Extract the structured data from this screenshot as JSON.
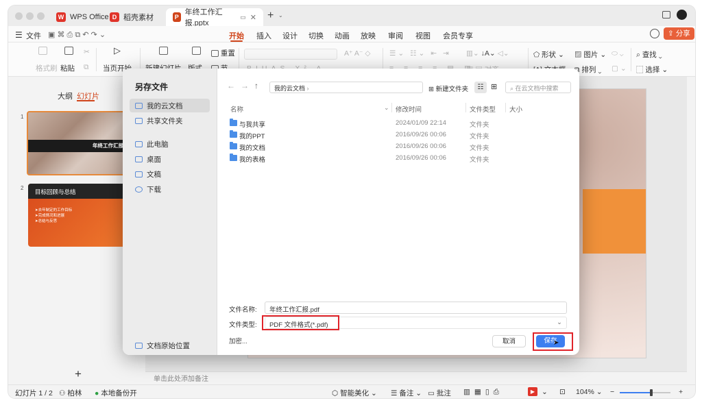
{
  "tabs": [
    {
      "label": "WPS Office",
      "icon": "wps-logo-icon"
    },
    {
      "label": "稻壳素材",
      "icon": "docer-logo-icon"
    },
    {
      "label": "年终工作汇报.pptx",
      "icon": "presentation-icon"
    }
  ],
  "menu": {
    "file": "文件",
    "items": [
      "开始",
      "插入",
      "设计",
      "切换",
      "动画",
      "放映",
      "审阅",
      "视图",
      "会员专享"
    ],
    "active": "开始",
    "share": "分享"
  },
  "ribbon": {
    "format_painter": "格式刷",
    "paste": "粘贴",
    "from_current": "当页开始",
    "new_slide": "新建幻灯片",
    "layout": "版式",
    "section": "节",
    "reset": "重置",
    "shape": "形状",
    "picture": "图片",
    "find": "查找",
    "textbox": "文本框",
    "arrange": "排列",
    "select": "选择",
    "align": "对齐"
  },
  "left_panel": {
    "tabs": [
      "大纲",
      "幻灯片"
    ],
    "active_tab": "幻灯片",
    "slides": [
      {
        "num": "1",
        "title": "年终工作汇报"
      },
      {
        "num": "2",
        "title": "目标回顾与总结",
        "bullets": [
          "去年制定的工作目标",
          "完成情况和进展",
          "总结与反思"
        ]
      }
    ],
    "add_icon": "+"
  },
  "notes_placeholder": "单击此处添加备注",
  "status": {
    "slide_info": "幻灯片 1 / 2",
    "theme": "柏林",
    "backup": "本地备份开",
    "beautify": "智能美化",
    "notes": "备注",
    "comments": "批注",
    "zoom": "104%",
    "zoom_level": 0.62
  },
  "dialog": {
    "title": "另存文件",
    "sidebar": [
      {
        "label": "我的云文档",
        "selected": true,
        "icon": "cloud-icon"
      },
      {
        "label": "共享文件夹",
        "selected": false,
        "icon": "share-folder-icon"
      },
      {
        "label": "此电脑",
        "selected": false,
        "icon": "computer-icon"
      },
      {
        "label": "桌面",
        "selected": false,
        "icon": "desktop-icon"
      },
      {
        "label": "文稿",
        "selected": false,
        "icon": "documents-icon"
      },
      {
        "label": "下载",
        "selected": false,
        "icon": "download-icon"
      }
    ],
    "original_location": "文档原始位置",
    "path": "我的云文档",
    "new_folder": "新建文件夹",
    "search_placeholder": "在云文档中搜索",
    "columns": [
      "名称",
      "修改时间",
      "文件类型",
      "大小"
    ],
    "files": [
      {
        "name": "与我共享",
        "modified": "2024/01/09 22:14",
        "type": "文件夹"
      },
      {
        "name": "我的PPT",
        "modified": "2016/09/26 00:06",
        "type": "文件夹"
      },
      {
        "name": "我的文档",
        "modified": "2016/09/26 00:06",
        "type": "文件夹"
      },
      {
        "name": "我的表格",
        "modified": "2016/09/26 00:06",
        "type": "文件夹"
      }
    ],
    "filename_label": "文件名称:",
    "filename": "年终工作汇报.pdf",
    "filetype_label": "文件类型:",
    "filetype": "PDF 文件格式(*.pdf)",
    "encrypt": "加密...",
    "cancel": "取消",
    "save": "保存"
  },
  "colors": {
    "accent": "#d0451b",
    "save_blue": "#3d7ff0",
    "highlight_red": "#e0242a",
    "slide_orange": "#f0913a"
  }
}
